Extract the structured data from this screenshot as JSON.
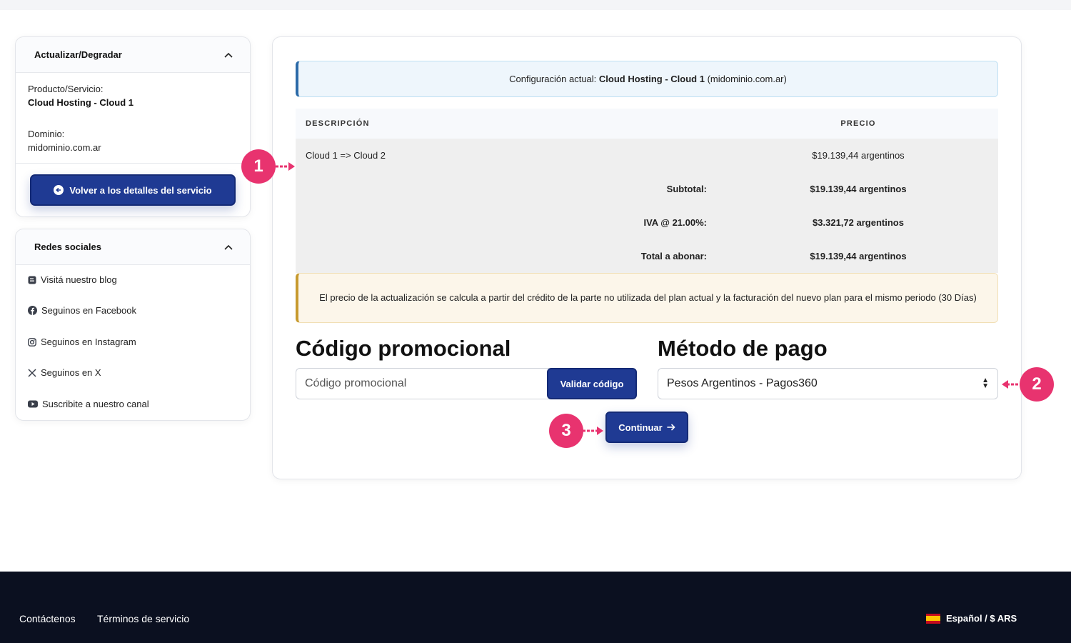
{
  "sidebar_upgrade": {
    "title": "Actualizar/Degradar",
    "product_label": "Producto/Servicio:",
    "product_value": "Cloud Hosting - Cloud 1",
    "domain_label": "Dominio:",
    "domain_value": "midominio.com.ar",
    "back_button": "Volver a los detalles del servicio"
  },
  "sidebar_social": {
    "title": "Redes sociales",
    "items": [
      {
        "label": "Visitá nuestro blog",
        "icon": "blog-icon"
      },
      {
        "label": "Seguinos en Facebook",
        "icon": "facebook-icon"
      },
      {
        "label": "Seguinos en Instagram",
        "icon": "instagram-icon"
      },
      {
        "label": "Seguinos en X",
        "icon": "x-icon"
      },
      {
        "label": "Suscribite a nuestro canal",
        "icon": "youtube-icon"
      }
    ]
  },
  "config": {
    "prefix": "Configuración actual:",
    "product": "Cloud Hosting - Cloud 1",
    "domain": "(midominio.com.ar)"
  },
  "table": {
    "headers": [
      "DESCRIPCIÓN",
      "PRECIO"
    ],
    "item": {
      "description": "Cloud 1 => Cloud 2",
      "price": "$19.139,44 argentinos"
    },
    "subtotal": {
      "label": "Subtotal:",
      "value": "$19.139,44 argentinos"
    },
    "tax": {
      "label": "IVA @ 21.00%:",
      "value": "$3.321,72 argentinos"
    },
    "total": {
      "label": "Total a abonar:",
      "value": "$19.139,44 argentinos"
    }
  },
  "notice": "El precio de la actualización se calcula a partir del crédito de la parte no utilizada del plan actual y la facturación del nuevo plan para el mismo periodo (30 Días)",
  "promo": {
    "title": "Código promocional",
    "placeholder": "Código promocional",
    "button": "Validar código"
  },
  "payment": {
    "title": "Método de pago",
    "selected": "Pesos Argentinos - Pagos360"
  },
  "continue_button": "Continuar",
  "callouts": [
    "1",
    "2",
    "3"
  ],
  "footer": {
    "links": [
      "Contáctenos",
      "Términos de servicio"
    ],
    "language": "Español / $ ARS"
  },
  "colors": {
    "primary": "#1f3a93",
    "callout": "#e8336f",
    "footer": "#0b1020"
  }
}
